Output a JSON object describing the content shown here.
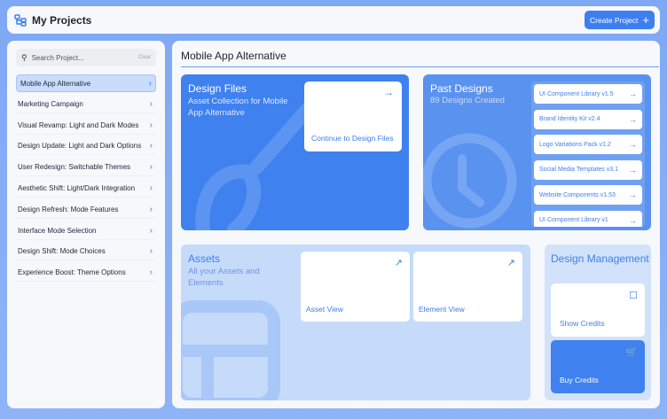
{
  "header": {
    "app_title": "My Projects",
    "create_label": "Create Project",
    "create_icon": "plus-icon",
    "logo_icon": "project-tree-icon"
  },
  "sidebar": {
    "search_placeholder": "Search Project...",
    "clear_label": "Clear",
    "items": [
      {
        "label": "Mobile App Alternative",
        "active": true
      },
      {
        "label": "Marketing Campaign"
      },
      {
        "label": "Visual Revamp: Light and Dark Modes"
      },
      {
        "label": "Design Update: Light and Dark Options"
      },
      {
        "label": "User Redesign: Switchable Themes"
      },
      {
        "label": "Aesthetic Shift: Light/Dark Integration"
      },
      {
        "label": "Design Refresh: Mode Features"
      },
      {
        "label": "Interface Mode Selection"
      },
      {
        "label": "Design Shift: Mode Choices"
      },
      {
        "label": "Experience Boost: Theme Options"
      }
    ]
  },
  "main": {
    "title": "Mobile App Alternative",
    "design_files": {
      "title": "Design Files",
      "subtitle": "Asset Collection for Mobile App Alternative",
      "continue_label": "Continue to Design Files"
    },
    "past_designs": {
      "title": "Past Designs",
      "subtitle": "89 Designs Created",
      "items": [
        "UI Component Library v1.5",
        "Brand Identity Kit v2.4",
        "Logo Variations Pack v1.2",
        "Social Media Templates v3.1",
        "Website Components v1.53",
        "UI Component Library v1"
      ]
    },
    "assets": {
      "title": "Assets",
      "subtitle": "All your Assets and Elements",
      "asset_view_label": "Asset View",
      "element_view_label": "Element View"
    },
    "management": {
      "title": "Design Management",
      "show_credits_label": "Show Credits",
      "buy_credits_label": "Buy Credits"
    }
  },
  "colors": {
    "accent": "#3d7ff0",
    "background": "#8fb3f7"
  }
}
